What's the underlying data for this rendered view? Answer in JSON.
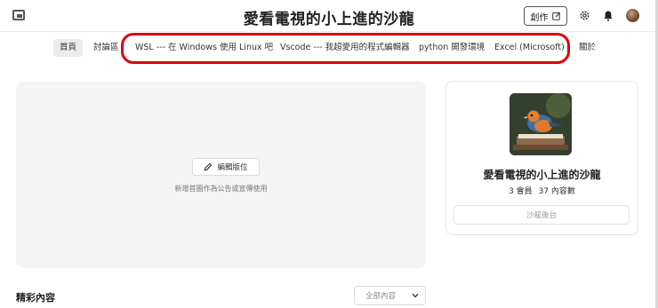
{
  "header": {
    "title": "愛看電視的小上進的沙龍",
    "create_label": "創作"
  },
  "nav": {
    "items": [
      {
        "label": "首頁"
      },
      {
        "label": "討論區"
      },
      {
        "label": "WSL --- 在 Windows 使用 Linux 吧"
      },
      {
        "label": "Vscode --- 我超愛用的程式編輯器"
      },
      {
        "label": "python 開發環境"
      },
      {
        "label": "Excel (Microsoft)"
      },
      {
        "label": "關於"
      }
    ]
  },
  "hero": {
    "edit_label": "編輯版位",
    "hint": "新增首圖作為公告或宣傳使用"
  },
  "card": {
    "title": "愛看電視的小上進的沙龍",
    "members": "3 會員",
    "contents": "37 內容數",
    "admin_label": "沙龍後台"
  },
  "featured": {
    "title": "精彩內容",
    "filter_value": "全部內容"
  },
  "colors": {
    "highlight": "#e00000",
    "hero_bg": "#f4f4f4"
  }
}
